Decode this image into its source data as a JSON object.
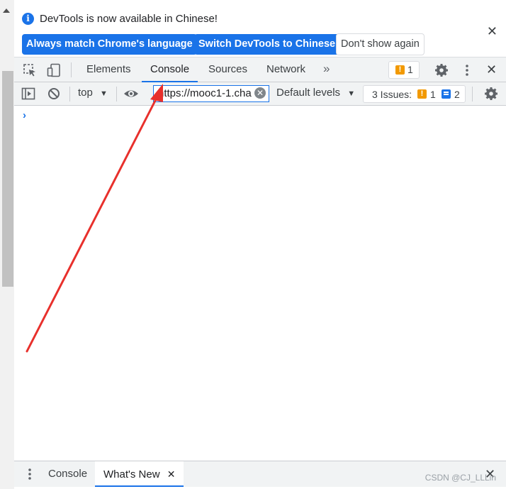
{
  "infobar": {
    "message": "DevTools is now available in Chinese!",
    "button_match": "Always match Chrome's language",
    "button_switch": "Switch DevTools to Chinese",
    "button_dismiss": "Don't show again",
    "close_glyph": "✕"
  },
  "tabs": {
    "items": [
      {
        "label": "Elements"
      },
      {
        "label": "Console"
      },
      {
        "label": "Sources"
      },
      {
        "label": "Network"
      }
    ],
    "active": "Console",
    "more_glyph": "»",
    "issues_count": "1",
    "close_glyph": "✕"
  },
  "console_toolbar": {
    "context": "top",
    "filter_value": "https://mooc1-1.cha",
    "levels": "Default levels",
    "issues_label": "3 Issues:",
    "warnings_count": "1",
    "info_count": "2"
  },
  "console": {
    "prompt_glyph": "›"
  },
  "drawer": {
    "tabs": [
      {
        "label": "Console"
      },
      {
        "label": "What's New"
      }
    ],
    "active": "What's New",
    "tab_close_glyph": "✕",
    "close_glyph": "✕"
  },
  "watermark": "CSDN @CJ_LLLin",
  "colors": {
    "accent": "#1a73e8",
    "warning": "#f29900",
    "annotation_arrow": "#e8302c"
  },
  "icons": [
    "info-icon",
    "inspect-element-icon",
    "device-toolbar-icon",
    "gear-icon",
    "kebab-menu-icon",
    "close-icon",
    "sidebar-toggle-icon",
    "clear-console-icon",
    "eye-icon",
    "warning-icon",
    "message-icon"
  ]
}
